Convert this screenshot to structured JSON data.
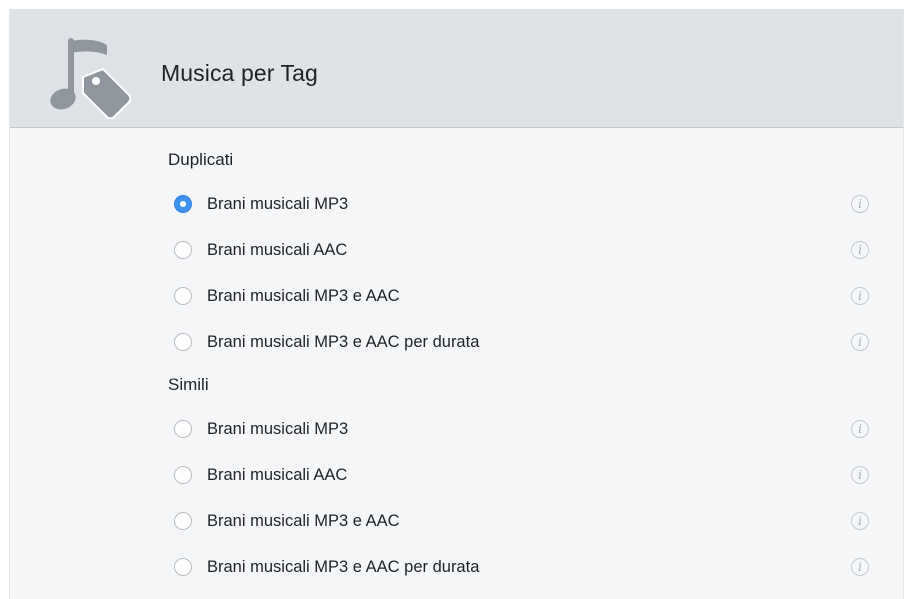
{
  "header": {
    "title": "Musica per Tag",
    "icon": "music-tag-icon"
  },
  "colors": {
    "header_bg": "#dfe3e8",
    "panel_bg": "#f5f6f7",
    "radio_selected": "#3c92f0"
  },
  "sections": [
    {
      "title": "Duplicati",
      "options": [
        {
          "label": "Brani musicali MP3",
          "selected": true
        },
        {
          "label": "Brani musicali AAC",
          "selected": false
        },
        {
          "label": "Brani musicali MP3 e AAC",
          "selected": false
        },
        {
          "label": "Brani musicali MP3 e AAC per durata",
          "selected": false
        }
      ]
    },
    {
      "title": "Simili",
      "options": [
        {
          "label": "Brani musicali MP3",
          "selected": false
        },
        {
          "label": "Brani musicali AAC",
          "selected": false
        },
        {
          "label": "Brani musicali MP3 e AAC",
          "selected": false
        },
        {
          "label": "Brani musicali MP3 e AAC per durata",
          "selected": false
        }
      ]
    }
  ],
  "info_glyph": "i"
}
